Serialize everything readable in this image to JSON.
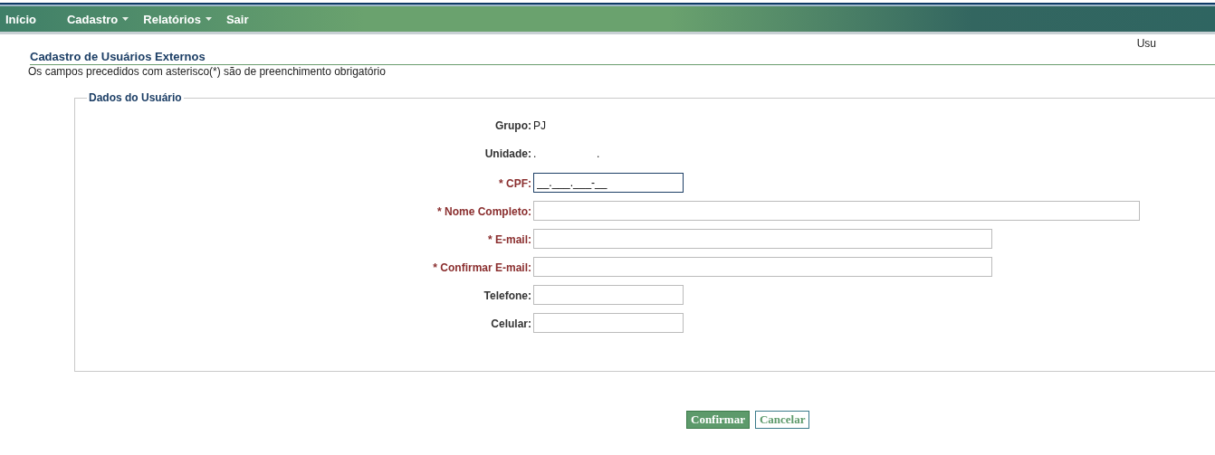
{
  "menu": [
    {
      "label": "Início",
      "dropdown": false
    },
    {
      "label": "Cadastro",
      "dropdown": true
    },
    {
      "label": "Relatórios",
      "dropdown": true
    },
    {
      "label": "Sair",
      "dropdown": false
    }
  ],
  "user_label": "Usu",
  "page": {
    "title": "Cadastro de Usuários Externos",
    "note": "Os campos precedidos com asterisco(*) são de preenchimento obrigatório"
  },
  "fieldset": {
    "legend": "Dados do Usuário",
    "rows": [
      {
        "kind": "text",
        "label": "Grupo:",
        "required": false,
        "value": "PJ"
      },
      {
        "kind": "text",
        "label": "Unidade:",
        "required": false,
        "value": ".                    ."
      },
      {
        "kind": "short",
        "label": "* CPF:",
        "required": true,
        "value": "__.___.___-__",
        "focused": true
      },
      {
        "kind": "wide",
        "label": "* Nome Completo:",
        "required": true,
        "focused": false
      },
      {
        "kind": "long",
        "label": "* E-mail:",
        "required": true,
        "focused": false
      },
      {
        "kind": "long",
        "label": "* Confirmar E-mail:",
        "required": true,
        "focused": false
      },
      {
        "kind": "short",
        "label": "Telefone:",
        "required": false,
        "focused": false
      },
      {
        "kind": "short",
        "label": "Celular:",
        "required": false,
        "focused": false
      }
    ]
  },
  "buttons": [
    {
      "label": "Confirmar",
      "primary": true
    },
    {
      "label": "Cancelar",
      "primary": false
    }
  ]
}
